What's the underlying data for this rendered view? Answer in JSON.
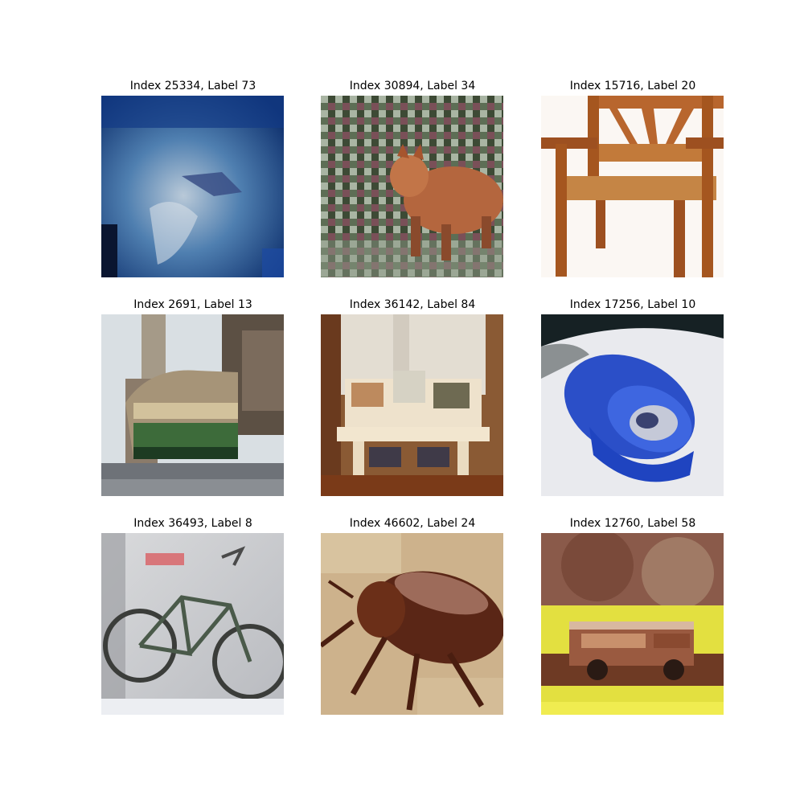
{
  "figure": {
    "panels": [
      {
        "title": "Index 25334, Label 73",
        "subject": "ray-underwater"
      },
      {
        "title": "Index 30894, Label 34",
        "subject": "fox-in-foliage"
      },
      {
        "title": "Index 15716, Label 20",
        "subject": "wooden-chair"
      },
      {
        "title": "Index 2691, Label 13",
        "subject": "streetcar"
      },
      {
        "title": "Index 36142, Label 84",
        "subject": "dining-table"
      },
      {
        "title": "Index 17256, Label 10",
        "subject": "blue-bowl"
      },
      {
        "title": "Index 36493, Label 8",
        "subject": "bicycle"
      },
      {
        "title": "Index 46602, Label 24",
        "subject": "cockroach"
      },
      {
        "title": "Index 12760, Label 58",
        "subject": "pickup-truck"
      }
    ]
  }
}
